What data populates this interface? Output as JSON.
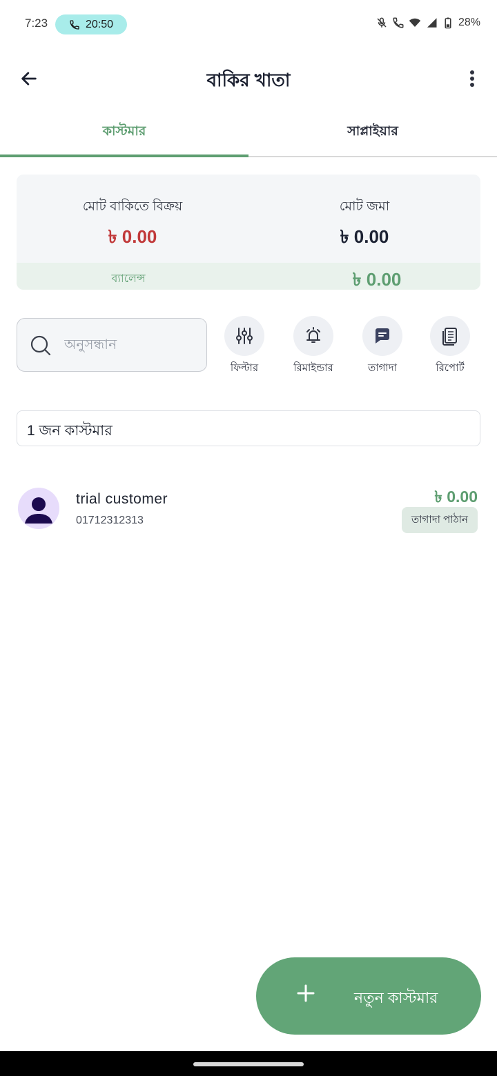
{
  "status_bar": {
    "time": "7:23",
    "call_duration": "20:50",
    "battery": "28%"
  },
  "app_bar": {
    "title": "বাকির খাতা"
  },
  "tabs": [
    {
      "label": "কাস্টমার",
      "active": true
    },
    {
      "label": "সাপ্লাইয়ার",
      "active": false
    }
  ],
  "summary": {
    "total_due_label": "মোট বাকিতে বিক্রয়",
    "total_due_value": "৳ 0.00",
    "total_deposit_label": "মোট জমা",
    "total_deposit_value": "৳ 0.00",
    "balance_label": "ব্যালেন্স",
    "balance_value": "৳ 0.00"
  },
  "search": {
    "placeholder": "অনুসন্ধান",
    "value": ""
  },
  "actions": [
    {
      "label": "ফিল্টার",
      "icon": "filter-icon"
    },
    {
      "label": "রিমাইন্ডার",
      "icon": "bell-icon"
    },
    {
      "label": "তাগাদা",
      "icon": "message-icon"
    },
    {
      "label": "রিপোর্ট",
      "icon": "report-icon"
    }
  ],
  "customer_count": "1 জন কাস্টমার",
  "customers": [
    {
      "name": "trial customer",
      "phone": "01712312313",
      "amount": "৳ 0.00",
      "reminder_label": "তাগাদা পাঠান"
    }
  ],
  "fab": {
    "label": "নতুন কাস্টমার"
  },
  "colors": {
    "accent": "#5e9e71",
    "fab": "#62a577",
    "due_red": "#c1393a",
    "call_chip": "#a8ecea"
  }
}
